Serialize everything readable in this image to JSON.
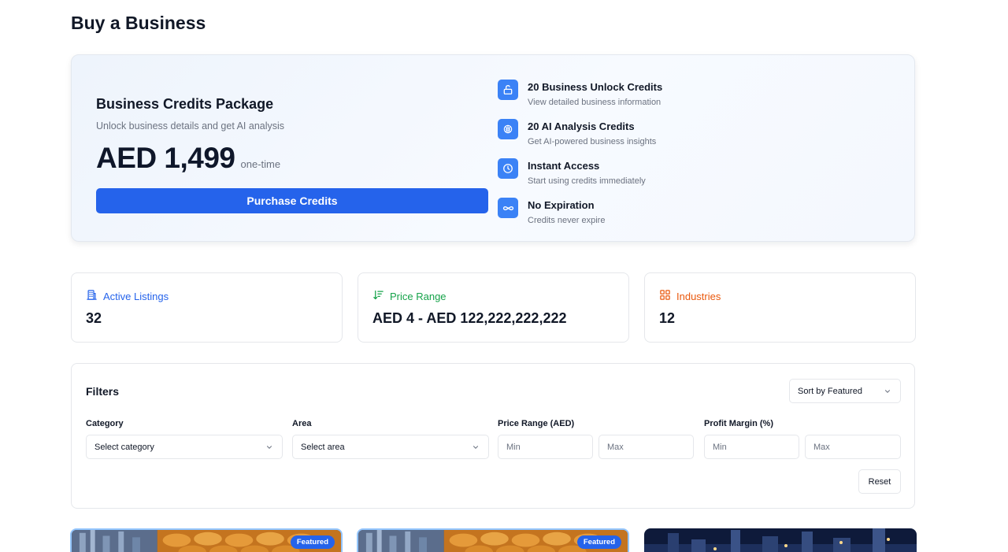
{
  "page": {
    "title": "Buy a Business"
  },
  "credits_package": {
    "title": "Business Credits Package",
    "subtitle": "Unlock business details and get AI analysis",
    "price": "AED 1,499",
    "period": "one-time",
    "purchase_label": "Purchase Credits",
    "features": [
      {
        "icon": "unlock-icon",
        "title": "20 Business Unlock Credits",
        "description": "View detailed business information"
      },
      {
        "icon": "brain-icon",
        "title": "20 AI Analysis Credits",
        "description": "Get AI-powered business insights"
      },
      {
        "icon": "clock-icon",
        "title": "Instant Access",
        "description": "Start using credits immediately"
      },
      {
        "icon": "infinity-icon",
        "title": "No Expiration",
        "description": "Credits never expire"
      }
    ]
  },
  "stats": [
    {
      "icon": "building-icon",
      "label": "Active Listings",
      "value": "32",
      "color": "#2563eb"
    },
    {
      "icon": "sort-down-icon",
      "label": "Price Range",
      "value": "AED 4 - AED 122,222,222,222",
      "color": "#16a34a"
    },
    {
      "icon": "grid-icon",
      "label": "Industries",
      "value": "12",
      "color": "#ea580c"
    }
  ],
  "filters": {
    "title": "Filters",
    "sort_value": "Sort by Featured",
    "category": {
      "label": "Category",
      "value": "Select category"
    },
    "area": {
      "label": "Area",
      "value": "Select area"
    },
    "price_range": {
      "label": "Price Range (AED)",
      "min_placeholder": "Min",
      "max_placeholder": "Max"
    },
    "profit_margin": {
      "label": "Profit Margin (%)",
      "min_placeholder": "Min",
      "max_placeholder": "Max"
    },
    "reset_label": "Reset"
  },
  "listings": [
    {
      "badge": "Featured"
    },
    {
      "badge": "Featured"
    },
    {
      "badge": ""
    }
  ],
  "colors": {
    "accent": "#2563eb",
    "feature_icon_bg": "#3b82f6"
  }
}
